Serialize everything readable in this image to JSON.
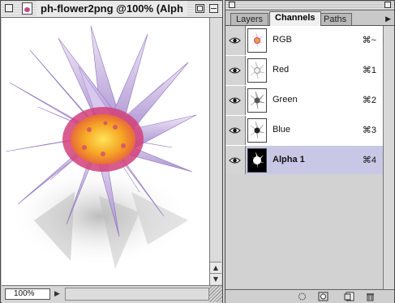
{
  "document": {
    "title": "ph-flower2png @100% (Alph",
    "zoom": "100%"
  },
  "palette": {
    "tabs": [
      {
        "label": "Layers",
        "active": false
      },
      {
        "label": "Channels",
        "active": true
      },
      {
        "label": "Paths",
        "active": false
      }
    ],
    "channels": [
      {
        "name": "RGB",
        "shortcut": "⌘~",
        "visible": true,
        "selected": false
      },
      {
        "name": "Red",
        "shortcut": "⌘1",
        "visible": true,
        "selected": false
      },
      {
        "name": "Green",
        "shortcut": "⌘2",
        "visible": true,
        "selected": false
      },
      {
        "name": "Blue",
        "shortcut": "⌘3",
        "visible": true,
        "selected": false
      },
      {
        "name": "Alpha 1",
        "shortcut": "⌘4",
        "visible": true,
        "selected": true
      }
    ],
    "bottom_buttons": [
      "load-selection-icon",
      "save-selection-icon",
      "new-channel-icon",
      "trash-icon"
    ]
  },
  "colors": {
    "petal": "#b9a1d8",
    "petal_light": "#e7dcf2",
    "center": "#f5a623",
    "center_ring": "#d2407a",
    "selection": "#c8c8e6"
  }
}
